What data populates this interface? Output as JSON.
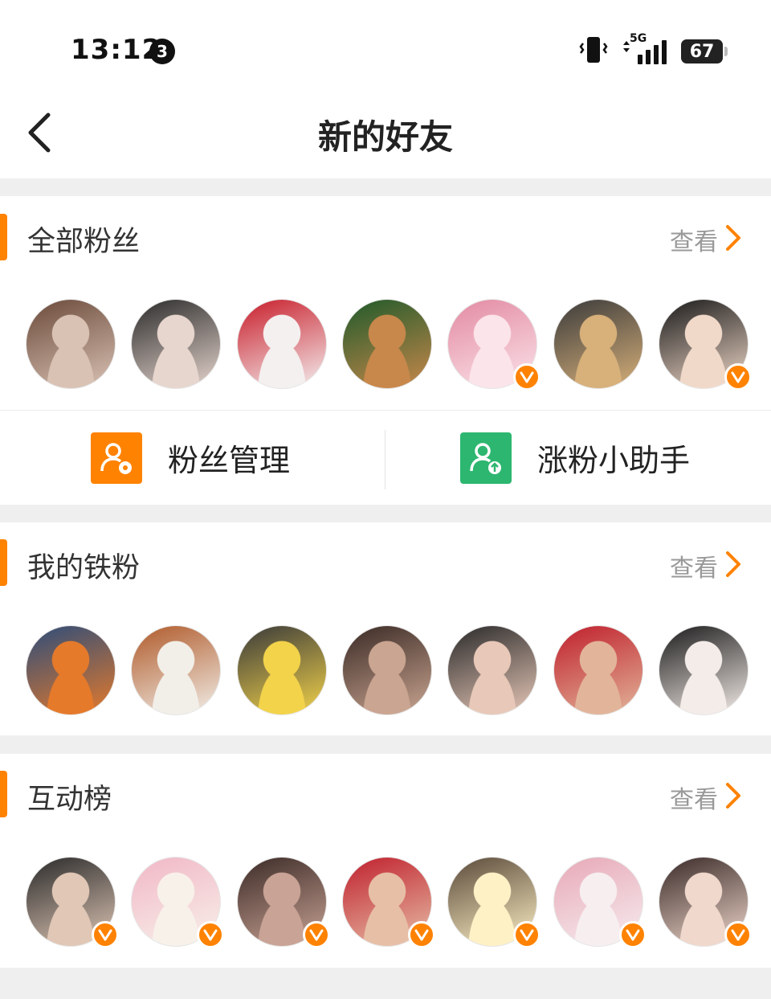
{
  "status": {
    "time": "13:12",
    "notification_count": "3",
    "network": "5G",
    "battery": "67"
  },
  "nav": {
    "title": "新的好友"
  },
  "sections": [
    {
      "title": "全部粉丝",
      "view_label": "查看",
      "avatars": [
        {
          "colors": [
            "#d9c2b4",
            "#6b4a3a"
          ],
          "verified": false
        },
        {
          "colors": [
            "#e7d6ce",
            "#2b2b2b"
          ],
          "verified": false
        },
        {
          "colors": [
            "#f4f0f0",
            "#c81d2a"
          ],
          "verified": false
        },
        {
          "colors": [
            "#c8884b",
            "#1f5a2a"
          ],
          "verified": false
        },
        {
          "colors": [
            "#fbe4ea",
            "#e38aa2"
          ],
          "verified": true
        },
        {
          "colors": [
            "#d7b07a",
            "#3b3b3b"
          ],
          "verified": false
        },
        {
          "colors": [
            "#f1d9c9",
            "#1a1a1a"
          ],
          "verified": true
        }
      ]
    },
    {
      "title": "我的铁粉",
      "view_label": "查看",
      "avatars": [
        {
          "colors": [
            "#e57a2b",
            "#2d4d7a"
          ],
          "verified": false
        },
        {
          "colors": [
            "#f2efe9",
            "#b05a2a"
          ],
          "verified": false
        },
        {
          "colors": [
            "#f3d34a",
            "#3a3a3a"
          ],
          "verified": false
        },
        {
          "colors": [
            "#caa591",
            "#3a2a25"
          ],
          "verified": false
        },
        {
          "colors": [
            "#e8c8b8",
            "#2a2a2a"
          ],
          "verified": false
        },
        {
          "colors": [
            "#e2b59a",
            "#c01f2c"
          ],
          "verified": false
        },
        {
          "colors": [
            "#f4ece8",
            "#1c1c1c"
          ],
          "verified": false
        }
      ]
    },
    {
      "title": "互动榜",
      "view_label": "查看",
      "avatars": [
        {
          "colors": [
            "#e0c7b6",
            "#2a2a2a"
          ],
          "verified": true
        },
        {
          "colors": [
            "#f8f1ea",
            "#f1b7c6"
          ],
          "verified": true
        },
        {
          "colors": [
            "#c9a395",
            "#3c2b27"
          ],
          "verified": true
        },
        {
          "colors": [
            "#e7bfa7",
            "#c0202d"
          ],
          "verified": true
        },
        {
          "colors": [
            "#fff1c6",
            "#5a4a3a"
          ],
          "verified": true
        },
        {
          "colors": [
            "#f7eef0",
            "#e7a8b7"
          ],
          "verified": true
        },
        {
          "colors": [
            "#f0d8cc",
            "#3a2a28"
          ],
          "verified": true
        }
      ]
    }
  ],
  "tools": {
    "fan_management": "粉丝管理",
    "growth_assistant": "涨粉小助手"
  },
  "colors": {
    "accent": "#ff8200",
    "green": "#2db66f"
  }
}
